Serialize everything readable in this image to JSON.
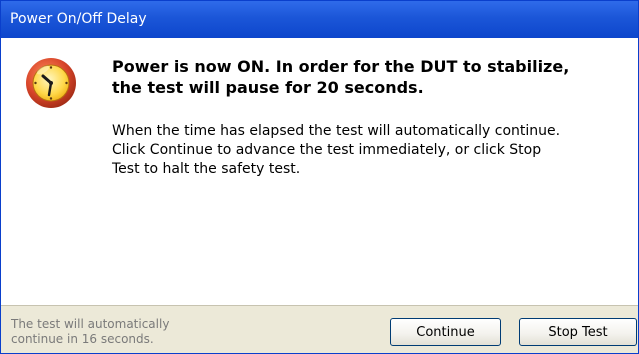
{
  "window": {
    "title": "Power On/Off Delay"
  },
  "icon": {
    "name": "alarm-clock-icon",
    "colors": {
      "rim": "#d8452a",
      "face": "#ffe47a",
      "hands": "#1a1a1a"
    }
  },
  "message": {
    "heading": "Power is now ON. In order for the DUT to stabilize,\nthe test will pause for 20 seconds.",
    "body": "When the time has elapsed the test will automatically continue.\nClick Continue to advance the test immediately, or click Stop\nTest to halt the safety test."
  },
  "footer": {
    "countdown_text": "The test will automatically\ncontinue in 16 seconds.",
    "continue_label": "Continue",
    "stop_label": "Stop Test"
  },
  "colors": {
    "titlebar": "#1b56d8",
    "footer_bg": "#ece9d8",
    "countdown_text": "#7a7a7a"
  }
}
